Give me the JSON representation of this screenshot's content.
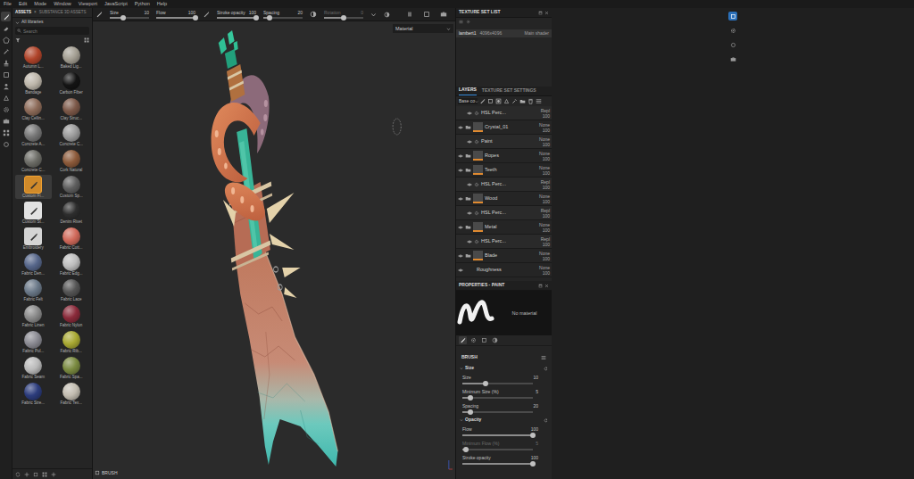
{
  "menu": [
    "File",
    "Edit",
    "Mode",
    "Window",
    "Viewport",
    "JavaScript",
    "Python",
    "Help"
  ],
  "tools": [
    {
      "selected": true
    },
    {
      "selected": false
    },
    {
      "selected": false
    },
    {
      "selected": false
    },
    {
      "selected": false
    },
    {
      "selected": false
    },
    {
      "selected": false
    },
    {
      "selected": false
    },
    {
      "selected": false
    },
    {
      "selected": false
    },
    {
      "selected": false
    },
    {
      "selected": false
    }
  ],
  "assets": {
    "tabs": [
      {
        "label": "ASSETS",
        "selected": true,
        "close": "×"
      },
      {
        "label": "SUBSTANCE 3D ASSETS",
        "selected": false
      }
    ],
    "library": "All libraries",
    "search": {
      "placeholder": "Search"
    },
    "items": [
      {
        "label": "Autumn L...",
        "color": "#b0442a",
        "kind": "material",
        "selected": false
      },
      {
        "label": "Baked Lig...",
        "color": "#a39e92",
        "kind": "material",
        "selected": false
      },
      {
        "label": "Bandage",
        "color": "#bdb6aa",
        "kind": "material",
        "selected": false
      },
      {
        "label": "Carbon Fiber",
        "color": "#141414",
        "kind": "material",
        "selected": false
      },
      {
        "label": "Clay Cellin...",
        "color": "#8c6a58",
        "kind": "material",
        "selected": false
      },
      {
        "label": "Clay Struc...",
        "color": "#7c5848",
        "kind": "material",
        "selected": false
      },
      {
        "label": "Concrete A...",
        "color": "#767676",
        "kind": "material",
        "selected": false
      },
      {
        "label": "Concrete C...",
        "color": "#9a9a9a",
        "kind": "material",
        "selected": false
      },
      {
        "label": "Concrete C...",
        "color": "#6c6c66",
        "kind": "material",
        "selected": false
      },
      {
        "label": "Cork Natural",
        "color": "#8c5a3a",
        "kind": "material",
        "selected": false
      },
      {
        "label": "Custom Fi...",
        "color": "#d08a2a",
        "kind": "tool",
        "selected": true
      },
      {
        "label": "Custom Sp...",
        "color": "#5e5e5e",
        "kind": "material",
        "selected": false
      },
      {
        "label": "Custom St...",
        "color": "#e2e2e2",
        "kind": "tool",
        "selected": false
      },
      {
        "label": "Denim Rivet",
        "color": "#2e2e2e",
        "kind": "material",
        "selected": false
      },
      {
        "label": "Embroidery",
        "color": "#d4d4d4",
        "kind": "tool",
        "selected": false
      },
      {
        "label": "Fabric Cott...",
        "color": "#d0695a",
        "kind": "material",
        "selected": false
      },
      {
        "label": "Fabric Den...",
        "color": "#56668a",
        "kind": "material",
        "selected": false
      },
      {
        "label": "Fabric Edg...",
        "color": "#bdbdbd",
        "kind": "material",
        "selected": false
      },
      {
        "label": "Fabric Felt",
        "color": "#6a7888",
        "kind": "material",
        "selected": false
      },
      {
        "label": "Fabric Lace",
        "color": "#555555",
        "kind": "material",
        "selected": false
      },
      {
        "label": "Fabric Linen",
        "color": "#8a8a8a",
        "kind": "material",
        "selected": false
      },
      {
        "label": "Fabric Nylon",
        "color": "#8a2a3a",
        "kind": "material",
        "selected": false
      },
      {
        "label": "Fabric Pol...",
        "color": "#8a8a92",
        "kind": "material",
        "selected": false
      },
      {
        "label": "Fabric Rib...",
        "color": "#a8a832",
        "kind": "material",
        "selected": false
      },
      {
        "label": "Fabric Seam",
        "color": "#bababa",
        "kind": "material",
        "selected": false
      },
      {
        "label": "Fabric Spa...",
        "color": "#7a8a40",
        "kind": "material",
        "selected": false
      },
      {
        "label": "Fabric Stre...",
        "color": "#2c3c7c",
        "kind": "material",
        "selected": false
      },
      {
        "label": "Fabric Tex...",
        "color": "#c2bcb0",
        "kind": "material",
        "selected": false
      }
    ]
  },
  "toolbar": {
    "sliders": [
      {
        "label": "Size",
        "value": "10",
        "level": 0.33,
        "disabled": false
      },
      {
        "label": "Flow",
        "value": "100",
        "level": 1,
        "disabled": false
      },
      {
        "label": "Stroke opacity",
        "value": "100",
        "level": 1,
        "disabled": false
      },
      {
        "label": "Spacing",
        "value": "20",
        "level": 0.15,
        "disabled": false
      },
      {
        "label": "Rotation",
        "value": "0",
        "level": 0.5,
        "disabled": true
      }
    ],
    "view_tools": [
      {
        "selected": false
      },
      {
        "selected": false
      },
      {
        "selected": false
      },
      {
        "selected": false
      },
      {
        "selected": false
      },
      {
        "selected": false
      },
      {
        "selected": false
      },
      {
        "selected": true
      }
    ]
  },
  "viewport": {
    "mode": "Material",
    "footer": "BRUSH"
  },
  "texture_set_list": {
    "title": "TEXTURE SET LIST",
    "rows": [
      {
        "name": "lambert1",
        "resolution": "4096x4096",
        "shader": "Main shader",
        "selected": true
      }
    ]
  },
  "layers": {
    "tabs": [
      {
        "label": "LAYERS",
        "selected": true
      },
      {
        "label": "TEXTURE SET SETTINGS",
        "selected": false
      }
    ],
    "channel": "Base co",
    "rows": [
      {
        "kind": "effect",
        "name": "HSL Perc...",
        "blend": "Repl",
        "opacity": "100",
        "visible": true
      },
      {
        "kind": "folder",
        "name": "Crystal_01",
        "blend": "None",
        "opacity": "100",
        "visible": true
      },
      {
        "kind": "effect",
        "name": "Paint",
        "blend": "None",
        "opacity": "100",
        "visible": true
      },
      {
        "kind": "folder",
        "name": "Ropes",
        "blend": "None",
        "opacity": "100",
        "visible": true
      },
      {
        "kind": "folder",
        "name": "Teeth",
        "blend": "None",
        "opacity": "100",
        "visible": true
      },
      {
        "kind": "effect",
        "name": "HSL Perc...",
        "blend": "Repl",
        "opacity": "100",
        "visible": true
      },
      {
        "kind": "folder",
        "name": "Wood",
        "blend": "None",
        "opacity": "100",
        "visible": true
      },
      {
        "kind": "effect",
        "name": "HSL Perc...",
        "blend": "Repl",
        "opacity": "100",
        "visible": true
      },
      {
        "kind": "folder",
        "name": "Metal",
        "blend": "None",
        "opacity": "100",
        "visible": true
      },
      {
        "kind": "effect",
        "name": "HSL Perc...",
        "blend": "Repl",
        "opacity": "100",
        "visible": true
      },
      {
        "kind": "folder",
        "name": "Blade",
        "blend": "None",
        "opacity": "100",
        "visible": true
      },
      {
        "kind": "fill",
        "name": "Roughness",
        "blend": "None",
        "opacity": "100",
        "visible": true
      }
    ]
  },
  "properties": {
    "title": "PROPERTIES - PAINT",
    "material": "No material",
    "tabs": [
      {
        "selected": true
      },
      {
        "selected": false
      },
      {
        "selected": false
      },
      {
        "selected": false
      }
    ],
    "section": "BRUSH",
    "groups": [
      {
        "title": "Size",
        "params": [
          {
            "label": "Size",
            "value": "10",
            "level": 0.33,
            "disabled": false
          },
          {
            "label": "Minimum Size (%)",
            "value": "5",
            "level": 0.12,
            "disabled": false
          },
          {
            "label": "Spacing",
            "value": "20",
            "level": 0.12,
            "disabled": false
          }
        ]
      },
      {
        "title": "Opacity",
        "params": [
          {
            "label": "Flow",
            "value": "100",
            "level": 1,
            "disabled": false
          },
          {
            "label": "Minimum Flow (%)",
            "value": "5",
            "level": 0.05,
            "disabled": true
          },
          {
            "label": "Stroke opacity",
            "value": "100",
            "level": 1,
            "disabled": false
          }
        ]
      }
    ]
  },
  "side_tabs": [
    {
      "selected": true
    },
    {
      "selected": false
    },
    {
      "selected": false
    },
    {
      "selected": false
    }
  ]
}
